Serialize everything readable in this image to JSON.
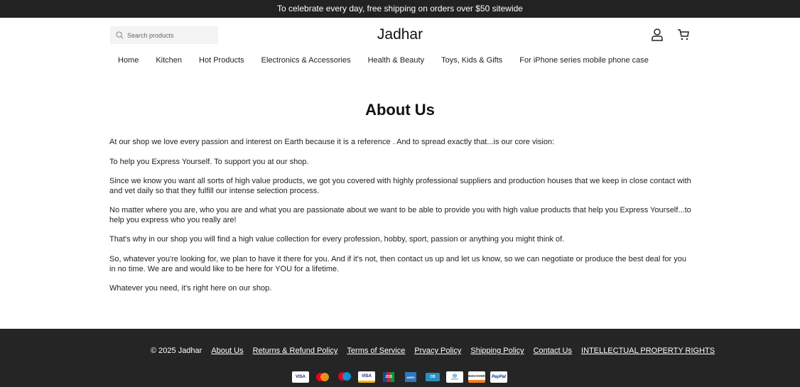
{
  "announcement": "To celebrate every day, free shipping on orders over $50 sitewide",
  "header": {
    "search_placeholder": "Search products",
    "logo": "Jadhar"
  },
  "nav": [
    "Home",
    "Kitchen",
    "Hot Products",
    "Electronics & Accessories",
    "Health & Beauty",
    "Toys, Kids & Gifts",
    "For iPhone series mobile phone case"
  ],
  "page": {
    "title": "About Us",
    "paragraphs": [
      "At our shop we love every passion and interest on Earth because it is a reference . And to spread exactly that...is our core vision:",
      "To help you Express Yourself. To support you at our shop.",
      "Since we know you want all sorts of high value products, we got you covered with highly professional suppliers and production houses that we keep in close contact with and vet daily so that they fulfill our intense selection process.",
      "No matter where you are, who you are and what you are passionate about we want to be able to provide you with high value products that help you Express Yourself...to help you express who you really are!",
      "That's why in our shop you will find a high value collection for every profession, hobby, sport, passion or anything you might think of.",
      "So, whatever you're looking for, we plan to have it there for you. And if it's not, then contact us up and let us know, so we can negotiate or produce the best deal for you in no time. We are and would like to be here for YOU for a lifetime.",
      "Whatever you need, it's right here on our shop."
    ]
  },
  "footer": {
    "copyright": "© 2025 Jadhar",
    "links": [
      "About Us",
      "Returns & Refund Policy",
      "Terms of Service",
      "Prvacy Policy",
      "Shipping Policy",
      "Contact Us",
      "INTELLECTUAL PROPERTY RIGHTS"
    ],
    "payments": [
      "VISA",
      "",
      "",
      "VISA",
      "JCB",
      "AMEX",
      "CB",
      "Diners",
      "DISCOVER",
      "PayPal"
    ]
  }
}
